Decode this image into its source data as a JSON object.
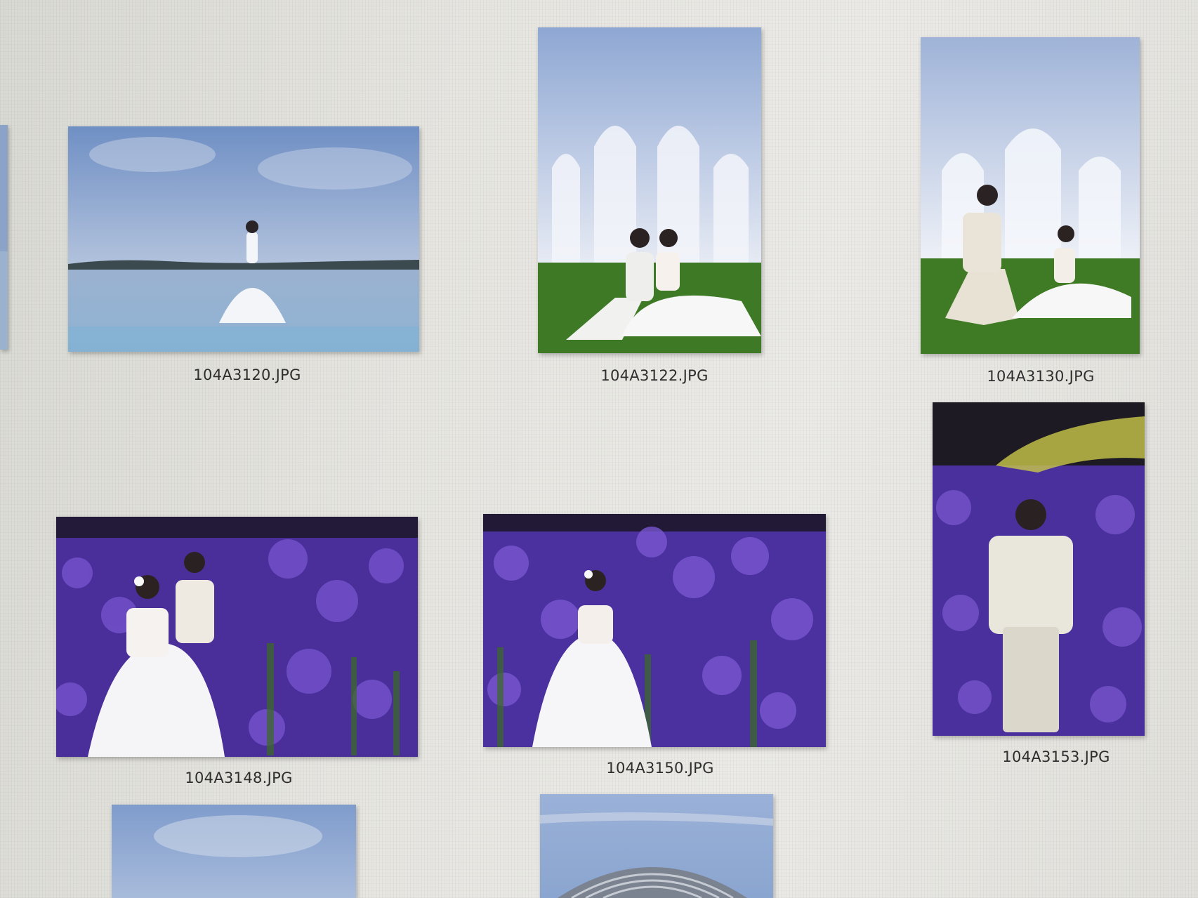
{
  "files": [
    {
      "name": "104A3120.JPG",
      "scene": "lake-bride",
      "selected": false
    },
    {
      "name": "104A3122.JPG",
      "scene": "castle-couple-sitting",
      "selected": false
    },
    {
      "name": "104A3130.JPG",
      "scene": "castle-proposal",
      "selected": false
    },
    {
      "name": "104A3148.JPG",
      "scene": "lavender-couple",
      "selected": false
    },
    {
      "name": "104A3150.JPG",
      "scene": "lavender-bride",
      "selected": false
    },
    {
      "name": "104A3153.JPG",
      "scene": "lavender-groom",
      "selected": false
    }
  ],
  "colors": {
    "sky": "#7f9ccb",
    "water": "#9cb9d6",
    "lavender": "#5e3fb4",
    "grass": "#3f7a25",
    "castle": "#e3e8f3"
  }
}
